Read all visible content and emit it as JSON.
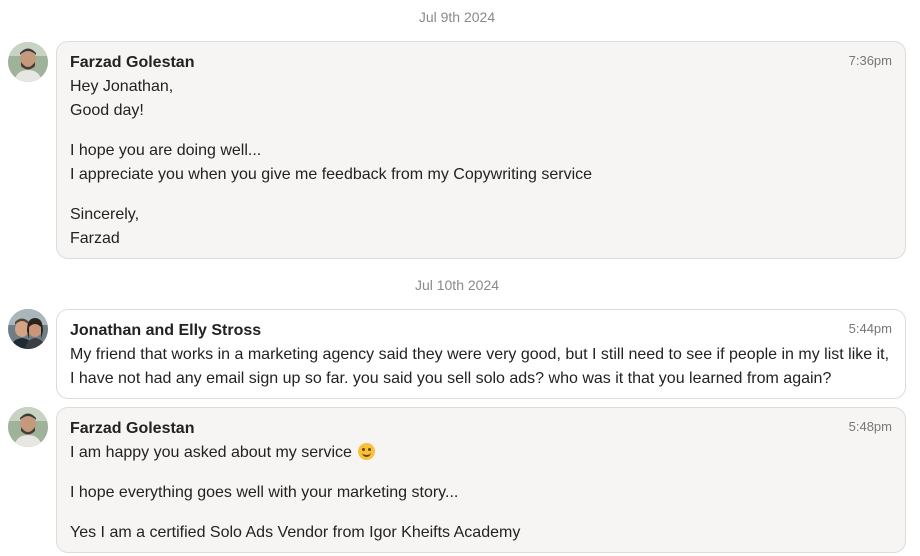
{
  "thread": {
    "groups": [
      {
        "date": "Jul 9th 2024",
        "messages": [
          {
            "sender": "Farzad Golestan",
            "time": "7:36pm",
            "avatar_icon": "avatar-farzad-photo",
            "paragraphs": [
              [
                "Hey Jonathan,",
                "Good day!"
              ],
              [
                "I hope you are doing well...",
                "I appreciate you when you give me feedback from my Copywriting service"
              ],
              [
                "Sincerely,",
                "Farzad"
              ]
            ]
          }
        ]
      },
      {
        "date": "Jul 10th 2024",
        "messages": [
          {
            "sender": "Jonathan and Elly Stross",
            "time": "5:44pm",
            "avatar_icon": "avatar-jonathan-elly-photo",
            "paragraphs": [
              [
                "My friend that works in a marketing agency said they were very good, but I still need to see if people in my list like it,",
                "I have not had any email sign up so far. you said you sell solo ads? who was it that you learned from again?"
              ]
            ]
          },
          {
            "sender": "Farzad Golestan",
            "time": "5:48pm",
            "avatar_icon": "avatar-farzad-photo",
            "paragraphs": [
              [
                "I am happy you asked about my service"
              ],
              [
                "I hope everything goes well with your marketing story..."
              ],
              [
                "Yes I am a certified Solo Ads Vendor from Igor Kheifts Academy"
              ]
            ],
            "emoji_icon": "smiling-face-emoji-icon"
          }
        ]
      }
    ]
  },
  "colors": {
    "bubble_gray": "#f6f5f4",
    "bubble_white": "#ffffff",
    "bubble_border": "#dedcda",
    "date_text": "#8a8a8a",
    "time_text": "#777777"
  }
}
